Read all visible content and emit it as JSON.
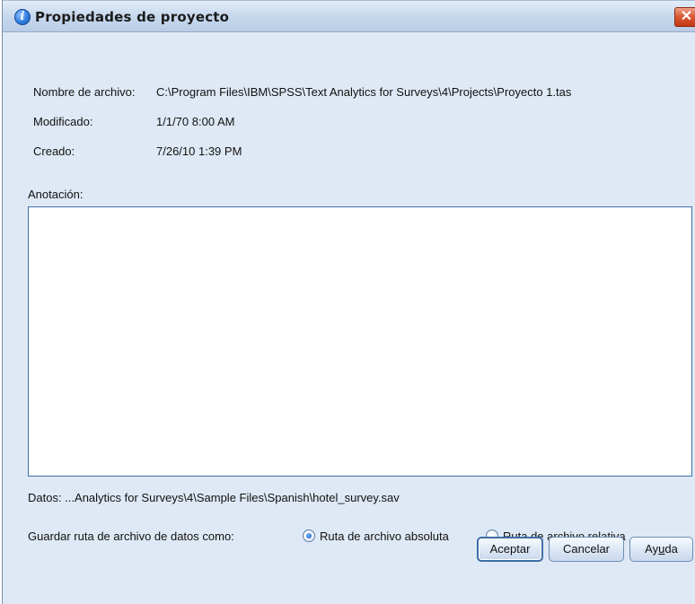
{
  "window": {
    "title": "Propiedades de proyecto",
    "close_glyph": "✕"
  },
  "file_info": {
    "filename_label": "Nombre de archivo:",
    "filename_value": "C:\\Program Files\\IBM\\SPSS\\Text Analytics for Surveys\\4\\Projects\\Proyecto 1.tas",
    "modified_label": "Modificado:",
    "modified_value": "1/1/70 8:00 AM",
    "created_label": "Creado:",
    "created_value": "7/26/10 1:39 PM"
  },
  "annotation": {
    "label": "Anotación:",
    "value": ""
  },
  "data": {
    "line": "Datos: ...Analytics for Surveys\\4\\Sample Files\\Spanish\\hotel_survey.sav"
  },
  "save_path": {
    "label": "Guardar ruta de archivo de datos como:",
    "options": [
      {
        "label": "Ruta de archivo absoluta",
        "selected": true
      },
      {
        "label": "Ruta de archivo relativa",
        "selected": false
      }
    ]
  },
  "buttons": {
    "ok": "Aceptar",
    "cancel": "Cancelar",
    "help_pre": "Ay",
    "help_u": "u",
    "help_post": "da"
  },
  "colors": {
    "dialog_bg": "#dfe9f5",
    "accent": "#3d6ea6",
    "close": "#d9552f"
  },
  "icons": {
    "title": "info-icon",
    "close": "close-icon"
  }
}
